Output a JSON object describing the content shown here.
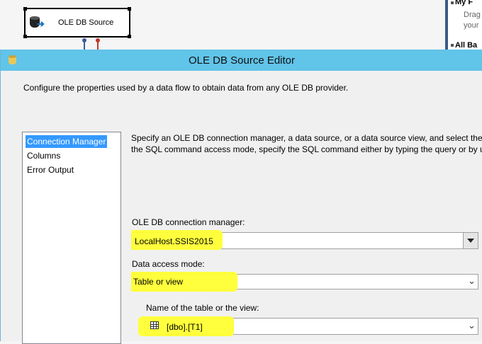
{
  "designer": {
    "component_title": "OLE DB Source"
  },
  "toolbox": {
    "header": "My F",
    "description_line1": "Drag",
    "description_line2": "your",
    "section": "All Ba"
  },
  "dialog": {
    "title": "OLE DB Source Editor",
    "description": "Configure the properties used by a data flow to obtain data from any OLE DB provider.",
    "nav": [
      {
        "label": "Connection Manager",
        "selected": true
      },
      {
        "label": "Columns",
        "selected": false
      },
      {
        "label": "Error Output",
        "selected": false
      }
    ],
    "instructions_line1": "Specify an OLE DB connection manager, a data source, or a data source view, and select the da",
    "instructions_line2": "the SQL command access mode, specify the SQL command either by typing the query or by u",
    "connection_manager": {
      "label": "OLE DB connection manager:",
      "value": "LocalHost.SSIS2015"
    },
    "data_access_mode": {
      "label": "Data access mode:",
      "value": "Table or view"
    },
    "table_name": {
      "label": "Name of the table or the view:",
      "value": "[dbo].[T1]"
    }
  },
  "colors": {
    "title_bar": "#61c4e9",
    "selection": "#3399ff",
    "highlight": "#ffff33",
    "path_blue": "#3a5ba0",
    "path_red": "#c0392b"
  }
}
